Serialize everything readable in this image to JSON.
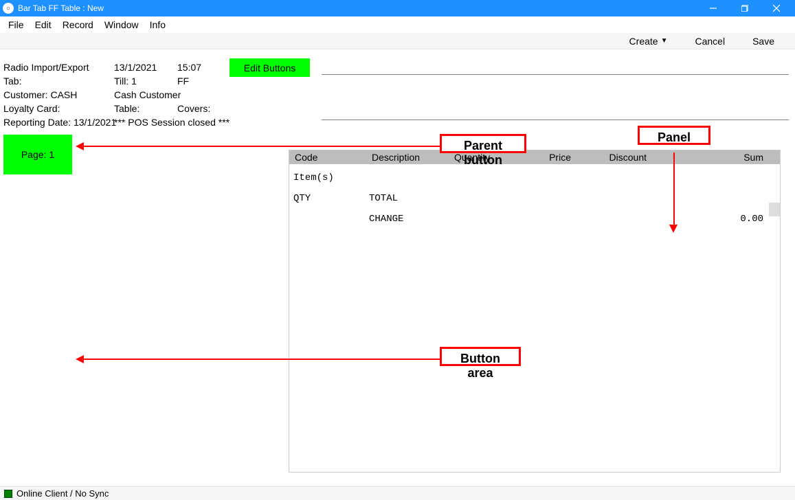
{
  "title": "Bar Tab FF Table : New",
  "menu": {
    "file": "File",
    "edit": "Edit",
    "record": "Record",
    "window": "Window",
    "info": "Info"
  },
  "toolbar": {
    "create": "Create",
    "cancel": "Cancel",
    "save": "Save"
  },
  "info": {
    "location": "Radio Import/Export",
    "date": "13/1/2021",
    "time": "15:07",
    "tab_label": "Tab:",
    "till_label": "Till: 1",
    "till_type": "FF",
    "customer_label": "Customer: CASH",
    "customer_name": "Cash Customer",
    "loyalty_label": "Loyalty Card:",
    "table_label": "Table:",
    "covers_label": "Covers:",
    "reporting_date_label": "Reporting Date: 13/1/2021",
    "session_status": "*** POS Session closed ***"
  },
  "edit_buttons_label": "Edit Buttons",
  "page_btn_label": "Page: 1",
  "panel": {
    "columns": {
      "code": "Code",
      "description": "Description",
      "quantity": "Quantity",
      "price": "Price",
      "discount": "Discount",
      "sum": "Sum"
    },
    "rows": {
      "items": "Item(s)",
      "qty_label": "QTY",
      "total_label": "TOTAL",
      "change_label": "CHANGE",
      "change_value": "0.00"
    }
  },
  "callouts": {
    "parent": "Parent button",
    "panel": "Panel",
    "area": "Button area"
  },
  "status": "Online Client / No Sync"
}
